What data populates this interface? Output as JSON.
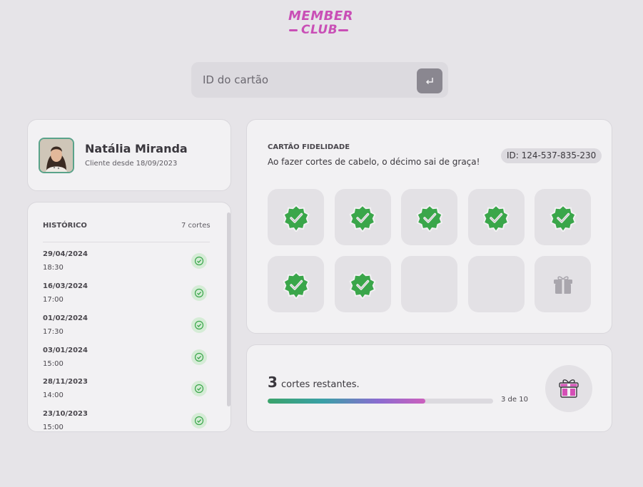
{
  "logo": {
    "line1": "MEMBER",
    "line2": "CLUB"
  },
  "search": {
    "placeholder": "ID do cartão",
    "value": ""
  },
  "client": {
    "name": "Natália Miranda",
    "since": "Cliente desde 18/09/2023"
  },
  "history": {
    "title": "HISTÓRICO",
    "count": "7 cortes",
    "entries": [
      {
        "date": "29/04/2024",
        "time": "18:30"
      },
      {
        "date": "16/03/2024",
        "time": "17:00"
      },
      {
        "date": "01/02/2024",
        "time": "17:30"
      },
      {
        "date": "03/01/2024",
        "time": "15:00"
      },
      {
        "date": "28/11/2023",
        "time": "14:00"
      },
      {
        "date": "23/10/2023",
        "time": "15:00"
      }
    ]
  },
  "loyalty": {
    "title": "CARTÃO FIDELIDADE",
    "description": "Ao fazer cortes de cabelo, o décimo sai de graça!",
    "card_id": "ID: 124-537-835-230",
    "stamps_filled": 7,
    "stamps_total": 10
  },
  "progress": {
    "remaining": "3",
    "remaining_label": "cortes restantes.",
    "fraction_text": "3 de 10",
    "fraction": 0.7
  },
  "colors": {
    "brand": "#c94fb6",
    "check": "#3aa64a",
    "background": "#e6e4e8"
  },
  "icons": {
    "enter": "enter-icon",
    "check": "check-badge-icon",
    "gift": "gift-icon"
  }
}
